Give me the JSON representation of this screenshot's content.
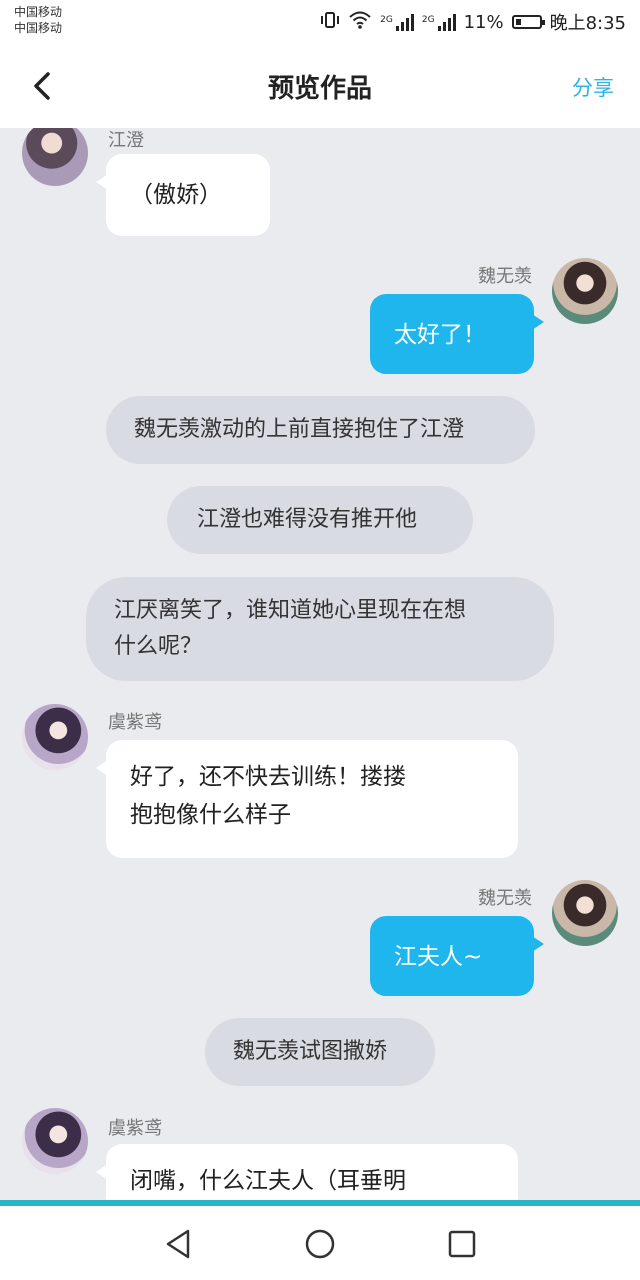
{
  "status": {
    "carrier1": "中国移动",
    "carrier2": "中国移动",
    "net1": "2G",
    "net2": "2G",
    "battery": "11%",
    "time": "晚上8:35"
  },
  "nav": {
    "title": "预览作品",
    "share": "分享"
  },
  "messages": {
    "m1": {
      "sender": "江澄",
      "text": "（傲娇）"
    },
    "m2": {
      "sender": "魏无羡",
      "text": "太好了！"
    },
    "n1": {
      "text": "魏无羡激动的上前直接抱住了江澄"
    },
    "n2": {
      "text": "江澄也难得没有推开他"
    },
    "n3": {
      "line1": "江厌离笑了，谁知道她心里现在在想",
      "line2": "什么呢？"
    },
    "m3": {
      "sender": "虞紫鸢",
      "line1": "好了，还不快去训练！搂搂",
      "line2": "抱抱像什么样子"
    },
    "m4": {
      "sender": "魏无羡",
      "text": "江夫人~"
    },
    "n4": {
      "text": "魏无羡试图撒娇"
    },
    "m5": {
      "sender": "虞紫鸢",
      "text": "闭嘴，什么江夫人（耳垂明"
    }
  },
  "colors": {
    "accent": "#2fb3e6",
    "right_bubble": "#1fb6ee",
    "chat_bg": "#eaebef",
    "narration_bg": "#d9dbe2"
  }
}
